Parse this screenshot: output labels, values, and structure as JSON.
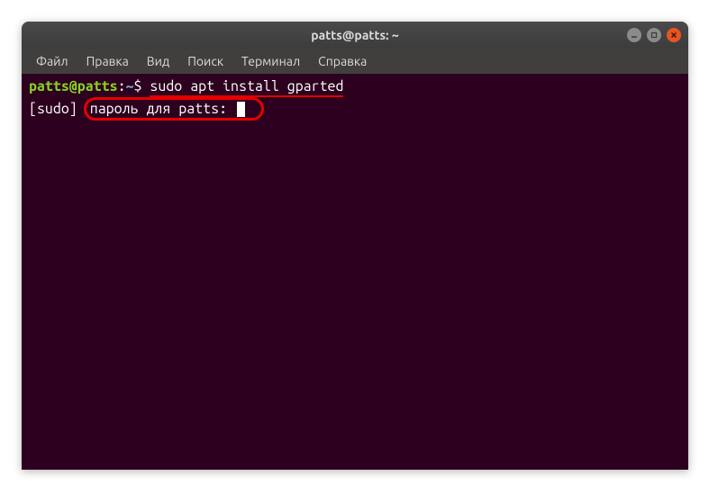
{
  "titlebar": {
    "title": "patts@patts: ~"
  },
  "menubar": {
    "items": [
      "Файл",
      "Правка",
      "Вид",
      "Поиск",
      "Терминал",
      "Справка"
    ]
  },
  "terminal": {
    "prompt_user": "patts@patts",
    "prompt_colon": ":",
    "prompt_path": "~",
    "prompt_dollar": "$ ",
    "command": "sudo apt install gparted",
    "sudo_prefix": "[sudo] ",
    "sudo_text": "пароль для patts: "
  },
  "colors": {
    "terminal_bg": "#2c001e",
    "prompt_green": "#88d222",
    "highlight_red": "#e60000",
    "close_btn": "#e95420"
  }
}
